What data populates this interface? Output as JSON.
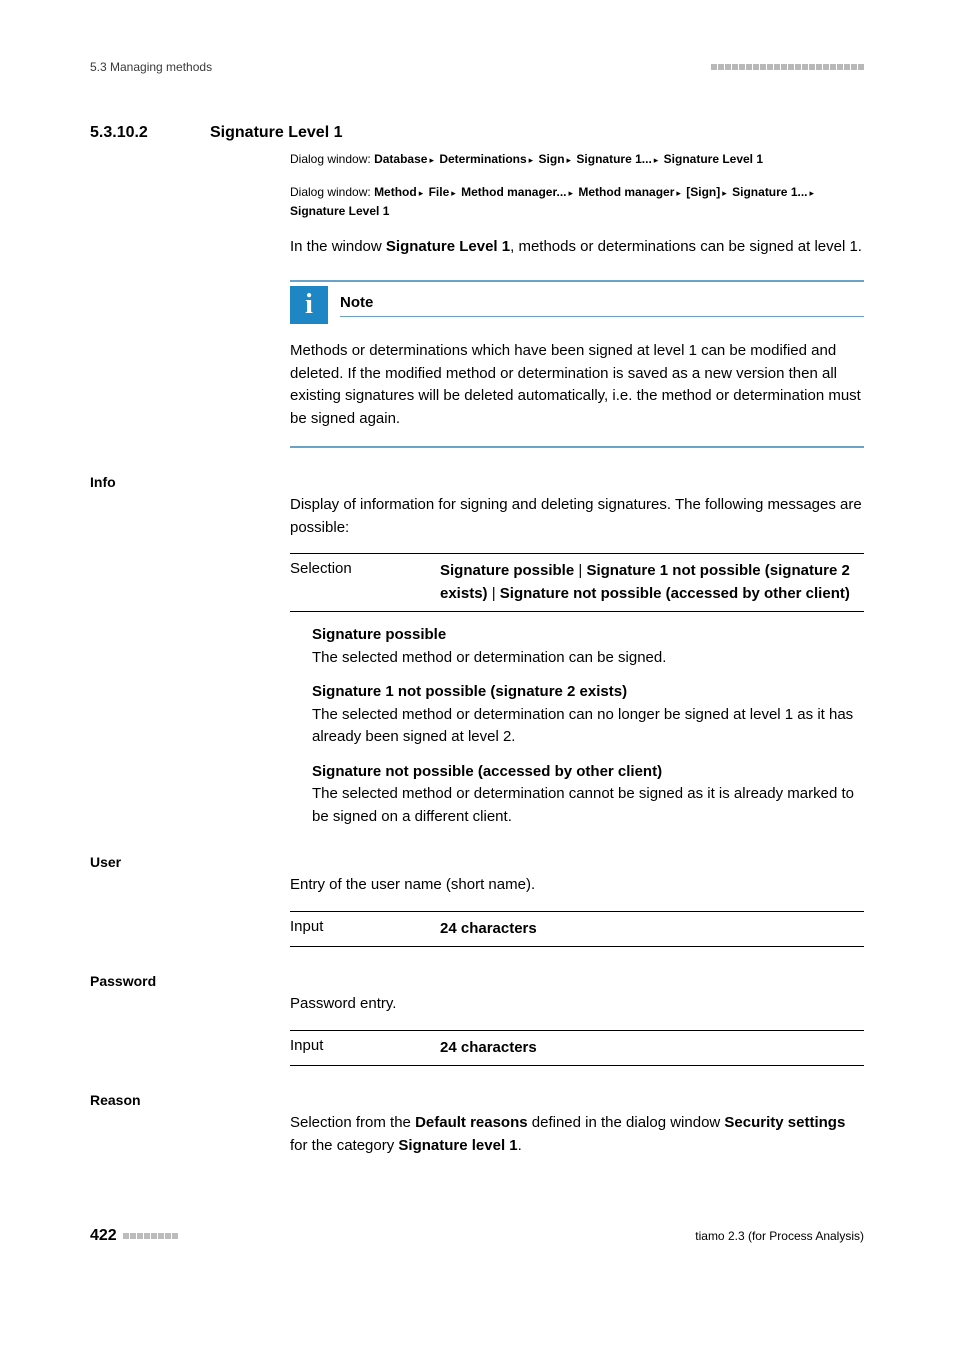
{
  "header": {
    "breadcrumb": "5.3 Managing methods"
  },
  "section": {
    "number": "5.3.10.2",
    "title": "Signature Level 1"
  },
  "dialog_path_1": {
    "prefix": "Dialog window:",
    "p1": "Database",
    "p2": "Determinations",
    "p3": "Sign",
    "p4": "Signature 1...",
    "p5": "Signature Level 1"
  },
  "dialog_path_2": {
    "prefix": "Dialog window:",
    "p1": "Method",
    "p2": "File",
    "p3": "Method manager...",
    "p4": "Method manager",
    "p5": "[Sign]",
    "p6": "Signature 1...",
    "p7": "Signature Level 1"
  },
  "intro": {
    "t1": "In the window ",
    "t2": "Signature Level 1",
    "t3": ", methods or determinations can be signed at level 1."
  },
  "note": {
    "title": "Note",
    "body": "Methods or determinations which have been signed at level 1 can be modified and deleted. If the modified method or determination is saved as a new version then all existing signatures will be deleted automatically, i.e. the method or determination must be signed again."
  },
  "info": {
    "label": "Info",
    "intro": "Display of information for signing and deleting signatures. The following messages are possible:",
    "selection_label": "Selection",
    "selection_val_1": "Signature possible",
    "selection_sep": " | ",
    "selection_val_2": "Signature 1 not possible (signature 2 exists)",
    "selection_val_3": "Signature not possible (accessed by other client)",
    "sub1_head": "Signature possible",
    "sub1_body": "The selected method or determination can be signed.",
    "sub2_head": "Signature 1 not possible (signature 2 exists)",
    "sub2_body": "The selected method or determination can no longer be signed at level 1 as it has already been signed at level 2.",
    "sub3_head": "Signature not possible (accessed by other client)",
    "sub3_body": "The selected method or determination cannot be signed as it is already marked to be signed on a different client."
  },
  "user": {
    "label": "User",
    "intro": "Entry of the user name (short name).",
    "input_label": "Input",
    "input_val": "24 characters"
  },
  "password": {
    "label": "Password",
    "intro": "Password entry.",
    "input_label": "Input",
    "input_val": "24 characters"
  },
  "reason": {
    "label": "Reason",
    "t1": "Selection from the ",
    "t2": "Default reasons",
    "t3": " defined in the dialog window ",
    "t4": "Security settings",
    "t5": " for the category ",
    "t6": "Signature level 1",
    "t7": "."
  },
  "footer": {
    "page": "422",
    "product": "tiamo 2.3 (for Process Analysis)"
  }
}
